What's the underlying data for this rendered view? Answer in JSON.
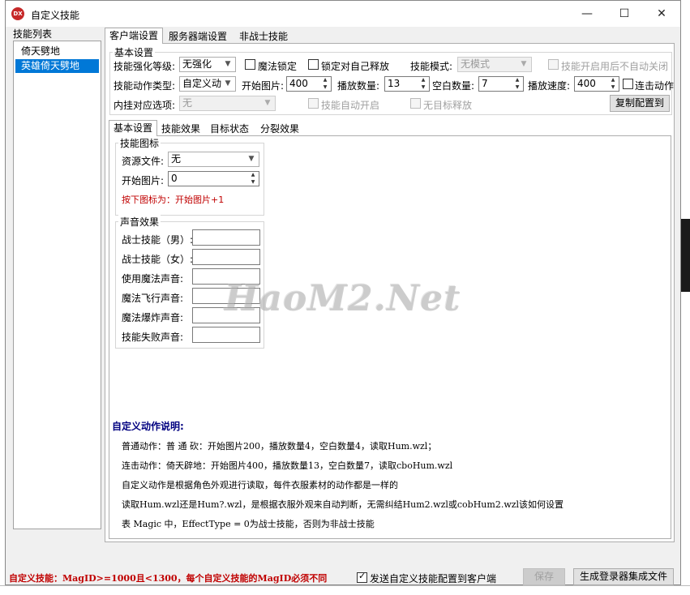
{
  "window": {
    "title": "自定义技能",
    "app_icon_text": "DX",
    "minimize_glyph": "—",
    "maximize_glyph": "☐",
    "close_glyph": "✕"
  },
  "skill_list": {
    "label": "技能列表",
    "items": [
      "倚天劈地",
      "英雄倚天劈地"
    ],
    "selected_index": 1
  },
  "top_tabs": [
    "客户端设置",
    "服务器端设置",
    "非战士技能"
  ],
  "basic_settings": {
    "group_label": "基本设置",
    "strengthen_level_label": "技能强化等级:",
    "strengthen_level_value": "无强化",
    "magic_lock_label": "魔法锁定",
    "lock_self_label": "锁定对自己释放",
    "skill_mode_label": "技能模式:",
    "skill_mode_value": "无模式",
    "no_auto_close_label": "技能开启用后不自动关闭",
    "action_type_label": "技能动作类型:",
    "action_type_value": "自定义动",
    "start_image_label": "开始图片:",
    "start_image_value": "400",
    "play_count_label": "播放数量:",
    "play_count_value": "13",
    "blank_count_label": "空白数量:",
    "blank_count_value": "7",
    "play_speed_label": "播放速度:",
    "play_speed_value": "400",
    "combo_action_label": "连击动作",
    "hang_option_label": "内挂对应选项:",
    "hang_option_value": "无",
    "auto_enable_label": "技能自动开启",
    "no_target_label": "无目标释放",
    "copy_config_label": "复制配置到"
  },
  "inner_tabs": [
    "基本设置",
    "技能效果",
    "目标状态",
    "分裂效果"
  ],
  "skill_icon": {
    "group_label": "技能图标",
    "resource_file_label": "资源文件:",
    "resource_file_value": "无",
    "start_image_label": "开始图片:",
    "start_image_value": "0",
    "hint": "按下图标为：开始图片+1"
  },
  "sound_effects": {
    "group_label": "声音效果",
    "rows": [
      "战士技能（男）:",
      "战士技能（女）:",
      "使用魔法声音:",
      "魔法飞行声音:",
      "魔法爆炸声音:",
      "技能失败声音:"
    ]
  },
  "explanation": {
    "title": "自定义动作说明:",
    "lines": [
      "普通动作：普 通 砍：开始图片200，播放数量4，空白数量4，读取Hum.wzl；",
      "连击动作：倚天辟地：开始图片400，播放数量13，空白数量7，读取cboHum.wzl",
      "自定义动作是根据角色外观进行读取，每件衣服素材的动作都是一样的",
      "读取Hum.wzl还是Hum?.wzl，是根据衣服外观来自动判断，无需纠结Hum2.wzl或cobHum2.wzl该如何设置",
      "表 Magic 中，EffectType = 0为战士技能，否则为非战士技能"
    ]
  },
  "footer": {
    "note": "自定义技能：MagID>=1000且<1300，每个自定义技能的MagID必须不同",
    "send_config_label": "发送自定义技能配置到客户端",
    "save_label": "保存",
    "generate_label": "生成登录器集成文件"
  },
  "watermark": "HaoM2.Net",
  "colors": {
    "selection": "#0078d7",
    "note_red": "#c00000",
    "explain_title": "#000080"
  }
}
